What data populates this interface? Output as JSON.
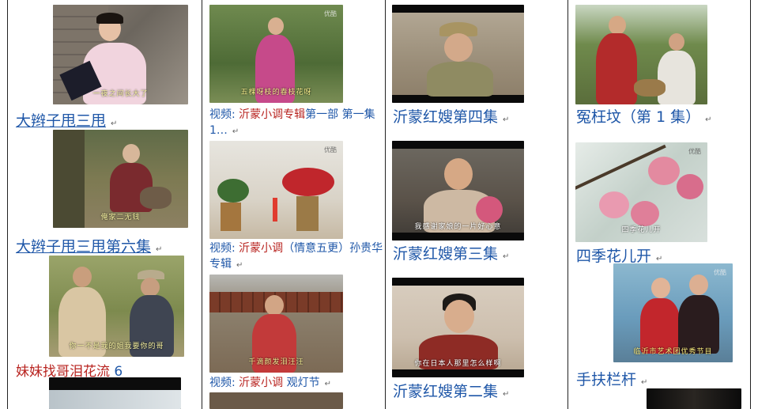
{
  "columns": [
    {
      "items": [
        {
          "title": "大辫子甩三甩",
          "subtitle": "一夜之间长大了"
        },
        {
          "title": "大辫子甩三甩第六集",
          "subtitle": "俺家二无钱"
        },
        {
          "title_red": "妹妹找哥泪花流",
          "title_suffix": "6",
          "subtitle": "你一不是我的姐我要你的哥"
        }
      ]
    },
    {
      "items": [
        {
          "prefix": "视频:",
          "red": "沂蒙小调专辑",
          "rest": "第一部 第一集 1…",
          "subtitle": "五棵呀枝的春枝花呀"
        },
        {
          "prefix": "视频:",
          "red": "沂蒙小调",
          "rest": "（情意五更）孙贵华专辑",
          "subtitle": ""
        },
        {
          "prefix": "视频:",
          "red": "沂蒙小调",
          "rest": " 观灯节",
          "subtitle": "千滴颜发泪汪汪"
        }
      ],
      "logo_text": "优酷"
    },
    {
      "items": [
        {
          "title": "沂蒙红嫂第四集",
          "subtitle": ""
        },
        {
          "title": "沂蒙红嫂第三集",
          "subtitle": "我感谢家娘的一片好心意"
        },
        {
          "title": "沂蒙红嫂第二集",
          "subtitle": "你在日本人那里怎么样啊"
        }
      ]
    },
    {
      "items": [
        {
          "title": "冤枉坟（第 1 集）",
          "subtitle": ""
        },
        {
          "title": "四季花儿开",
          "subtitle": "四季花儿开"
        },
        {
          "title": "手扶栏杆",
          "subtitle": "临沂市艺术团优秀节目"
        }
      ]
    }
  ],
  "paragraph_mark": "↵"
}
